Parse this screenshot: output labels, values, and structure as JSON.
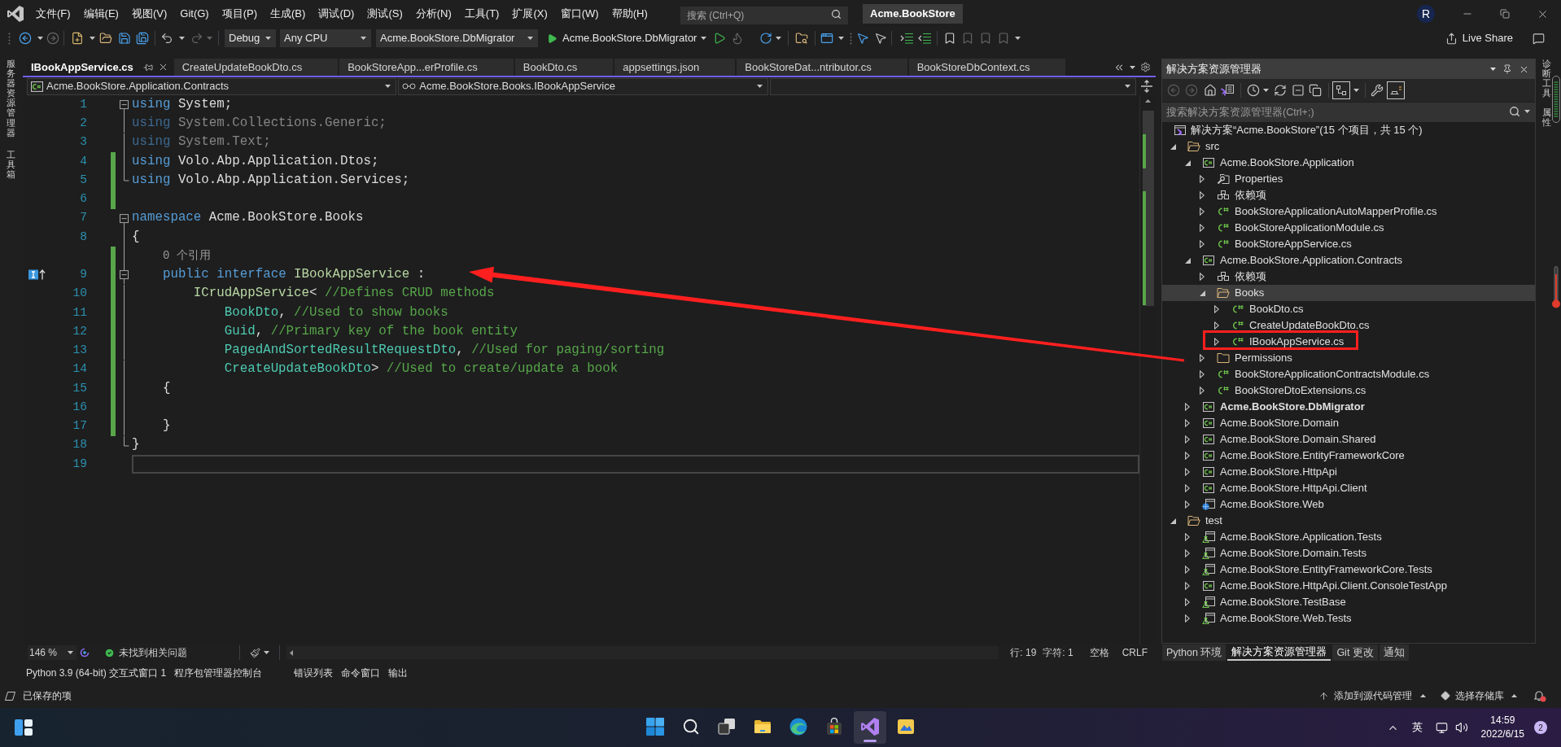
{
  "menu_bar": {
    "items": [
      "文件(F)",
      "编辑(E)",
      "视图(V)",
      "Git(G)",
      "项目(P)",
      "生成(B)",
      "调试(D)",
      "测试(S)",
      "分析(N)",
      "工具(T)",
      "扩展(X)",
      "窗口(W)",
      "帮助(H)"
    ],
    "search": {
      "placeholder": "搜索 (Ctrl+Q)"
    },
    "solution_name": "Acme.BookStore",
    "account_initial": "R"
  },
  "toolbar": {
    "configuration": "Debug",
    "platform": "Any CPU",
    "startup_project": "Acme.BookStore.DbMigrator",
    "run_target": "Acme.BookStore.DbMigrator",
    "live_share": "Live Share"
  },
  "left_strip": [
    "服务器资源管理器",
    "工具箱"
  ],
  "editor": {
    "tabs": [
      {
        "label": "IBookAppService.cs",
        "selected": true
      },
      {
        "label": "CreateUpdateBookDto.cs",
        "selected": false
      },
      {
        "label": "BookStoreApp...erProfile.cs",
        "selected": false
      },
      {
        "label": "BookDto.cs",
        "selected": false
      },
      {
        "label": "appsettings.json",
        "selected": false
      },
      {
        "label": "BookStoreDat...ntributor.cs",
        "selected": false
      },
      {
        "label": "BookStoreDbContext.cs",
        "selected": false
      }
    ],
    "navigation": {
      "project": "Acme.BookStore.Application.Contracts",
      "type": "Acme.BookStore.Books.IBookAppService"
    },
    "lines": [
      {
        "kind": "code",
        "number": "1",
        "tokens": [
          {
            "text": "using",
            "kind": "keyword"
          },
          {
            "text": " System;",
            "kind": "plain"
          }
        ],
        "changed": false,
        "faded": false,
        "fold_start": true,
        "in_fold": false,
        "fold_end": false,
        "marker": false,
        "current": false
      },
      {
        "kind": "code",
        "number": "2",
        "tokens": [
          {
            "text": "using",
            "kind": "keyword"
          },
          {
            "text": " System.Collections.Generic;",
            "kind": "plain"
          }
        ],
        "changed": false,
        "faded": true,
        "fold_start": false,
        "in_fold": true,
        "fold_end": false,
        "marker": false,
        "current": false
      },
      {
        "kind": "code",
        "number": "3",
        "tokens": [
          {
            "text": "using",
            "kind": "keyword"
          },
          {
            "text": " System.Text;",
            "kind": "plain"
          }
        ],
        "changed": false,
        "faded": true,
        "fold_start": false,
        "in_fold": true,
        "fold_end": false,
        "marker": false,
        "current": false
      },
      {
        "kind": "code",
        "number": "4",
        "tokens": [
          {
            "text": "using",
            "kind": "keyword"
          },
          {
            "text": " Volo.Abp.Application.Dtos;",
            "kind": "plain"
          }
        ],
        "changed": true,
        "faded": false,
        "fold_start": false,
        "in_fold": true,
        "fold_end": false,
        "marker": false,
        "current": false
      },
      {
        "kind": "code",
        "number": "5",
        "tokens": [
          {
            "text": "using",
            "kind": "keyword"
          },
          {
            "text": " Volo.Abp.Application.Services;",
            "kind": "plain"
          }
        ],
        "changed": true,
        "faded": false,
        "fold_start": false,
        "in_fold": true,
        "fold_end": true,
        "marker": false,
        "current": false
      },
      {
        "kind": "code",
        "number": "6",
        "changed": true,
        "fold_start": false,
        "in_fold": false,
        "fold_end": false,
        "marker": false,
        "current": false
      },
      {
        "kind": "code",
        "number": "7",
        "tokens": [
          {
            "text": "namespace",
            "kind": "keyword"
          },
          {
            "text": " Acme.BookStore.Books",
            "kind": "plain"
          }
        ],
        "changed": false,
        "faded": false,
        "fold_start": true,
        "in_fold": false,
        "fold_end": false,
        "marker": false,
        "current": false
      },
      {
        "kind": "code",
        "number": "8",
        "tokens": [
          {
            "text": "{",
            "kind": "plain"
          }
        ],
        "changed": false,
        "faded": false,
        "fold_start": false,
        "in_fold": true,
        "fold_end": false,
        "marker": false,
        "current": false
      },
      {
        "kind": "codelens",
        "text": "    0 个引用",
        "changed": true,
        "fold_start": false,
        "in_fold": true,
        "fold_end": false
      },
      {
        "kind": "code",
        "number": "9",
        "tokens": [
          {
            "text": "    public",
            "kind": "keyword"
          },
          {
            "text": " interface",
            "kind": "keyword"
          },
          {
            "text": " IBookAppService",
            "kind": "interface"
          },
          {
            "text": " :",
            "kind": "plain"
          }
        ],
        "changed": true,
        "faded": false,
        "fold_start": true,
        "in_fold": true,
        "fold_end": false,
        "marker": true,
        "current": false
      },
      {
        "kind": "code",
        "number": "10",
        "tokens": [
          {
            "text": "        ICrudAppService",
            "kind": "interface"
          },
          {
            "text": "< ",
            "kind": "plain"
          },
          {
            "text": "//Defines CRUD methods",
            "kind": "comment"
          }
        ],
        "changed": true,
        "faded": false,
        "fold_start": false,
        "in_fold": true,
        "fold_end": false,
        "marker": false,
        "current": false
      },
      {
        "kind": "code",
        "number": "11",
        "tokens": [
          {
            "text": "            BookDto",
            "kind": "type"
          },
          {
            "text": ", ",
            "kind": "plain"
          },
          {
            "text": "//Used to show books",
            "kind": "comment"
          }
        ],
        "changed": true,
        "faded": false,
        "fold_start": false,
        "in_fold": true,
        "fold_end": false,
        "marker": false,
        "current": false
      },
      {
        "kind": "code",
        "number": "12",
        "tokens": [
          {
            "text": "            Guid",
            "kind": "type"
          },
          {
            "text": ", ",
            "kind": "plain"
          },
          {
            "text": "//Primary key of the book entity",
            "kind": "comment"
          }
        ],
        "changed": true,
        "faded": false,
        "fold_start": false,
        "in_fold": true,
        "fold_end": false,
        "marker": false,
        "current": false
      },
      {
        "kind": "code",
        "number": "13",
        "tokens": [
          {
            "text": "            PagedAndSortedResultRequestDto",
            "kind": "type"
          },
          {
            "text": ", ",
            "kind": "plain"
          },
          {
            "text": "//Used for paging/sorting",
            "kind": "comment"
          }
        ],
        "changed": true,
        "faded": false,
        "fold_start": false,
        "in_fold": true,
        "fold_end": false,
        "marker": false,
        "current": false
      },
      {
        "kind": "code",
        "number": "14",
        "tokens": [
          {
            "text": "            CreateUpdateBookDto",
            "kind": "type"
          },
          {
            "text": "> ",
            "kind": "plain"
          },
          {
            "text": "//Used to create/update a book",
            "kind": "comment"
          }
        ],
        "changed": true,
        "faded": false,
        "fold_start": false,
        "in_fold": true,
        "fold_end": false,
        "marker": false,
        "current": false
      },
      {
        "kind": "code",
        "number": "15",
        "tokens": [
          {
            "text": "    {",
            "kind": "plain"
          }
        ],
        "changed": true,
        "faded": false,
        "fold_start": false,
        "in_fold": true,
        "fold_end": false,
        "marker": false,
        "current": false
      },
      {
        "kind": "code",
        "number": "16",
        "changed": true,
        "fold_start": false,
        "in_fold": true,
        "fold_end": false,
        "marker": false,
        "current": false
      },
      {
        "kind": "code",
        "number": "17",
        "tokens": [
          {
            "text": "    }",
            "kind": "plain"
          }
        ],
        "changed": true,
        "faded": false,
        "fold_start": false,
        "in_fold": true,
        "fold_end": false,
        "marker": false,
        "current": false
      },
      {
        "kind": "code",
        "number": "18",
        "tokens": [
          {
            "text": "}",
            "kind": "plain"
          }
        ],
        "changed": false,
        "faded": false,
        "fold_start": false,
        "in_fold": true,
        "fold_end": true,
        "marker": false,
        "current": false
      },
      {
        "kind": "code",
        "number": "19",
        "changed": false,
        "fold_start": false,
        "in_fold": false,
        "fold_end": false,
        "marker": false,
        "current": true
      }
    ],
    "footer": {
      "zoom": "146 %",
      "issues": "未找到相关问题",
      "line": "行: 19",
      "column": "字符: 1",
      "indentation": "空格",
      "line_ending": "CRLF"
    }
  },
  "solution_explorer": {
    "title": "解决方案资源管理器",
    "search": {
      "placeholder": "搜索解决方案资源管理器(Ctrl+;)"
    },
    "solution": {
      "label": "解决方案“Acme.BookStore”(15 个项目，共 15 个)",
      "children": [
        {
          "label": "src",
          "kind": "folder",
          "expanded": true,
          "selected": false,
          "children": [
            {
              "label": "Acme.BookStore.Application",
              "kind": "project",
              "expanded": true,
              "selected": false,
              "children": [
                {
                  "label": "Properties",
                  "kind": "properties",
                  "expanded": false,
                  "selected": false
                },
                {
                  "label": "依赖项",
                  "kind": "dependencies",
                  "expanded": false,
                  "selected": false
                },
                {
                  "label": "BookStoreApplicationAutoMapperProfile.cs",
                  "kind": "csharp-file",
                  "expanded": false,
                  "selected": false
                },
                {
                  "label": "BookStoreApplicationModule.cs",
                  "kind": "csharp-file",
                  "expanded": false,
                  "selected": false
                },
                {
                  "label": "BookStoreAppService.cs",
                  "kind": "csharp-file",
                  "expanded": false,
                  "selected": false
                }
              ]
            },
            {
              "label": "Acme.BookStore.Application.Contracts",
              "kind": "project",
              "expanded": true,
              "selected": false,
              "children": [
                {
                  "label": "依赖项",
                  "kind": "dependencies",
                  "expanded": false,
                  "selected": false
                },
                {
                  "label": "Books",
                  "kind": "folder",
                  "expanded": true,
                  "selected": true,
                  "children": [
                    {
                      "label": "BookDto.cs",
                      "kind": "csharp-file",
                      "expanded": false,
                      "selected": false
                    },
                    {
                      "label": "CreateUpdateBookDto.cs",
                      "kind": "csharp-file",
                      "expanded": false,
                      "selected": false
                    },
                    {
                      "label": "IBookAppService.cs",
                      "kind": "csharp-file",
                      "expanded": false,
                      "selected": false
                    }
                  ]
                },
                {
                  "label": "Permissions",
                  "kind": "folder",
                  "expanded": false,
                  "selected": false
                },
                {
                  "label": "BookStoreApplicationContractsModule.cs",
                  "kind": "csharp-file",
                  "expanded": false,
                  "selected": false
                },
                {
                  "label": "BookStoreDtoExtensions.cs",
                  "kind": "csharp-file",
                  "expanded": false,
                  "selected": false
                }
              ]
            },
            {
              "label": "Acme.BookStore.DbMigrator",
              "kind": "startup-project",
              "expanded": false,
              "selected": false
            },
            {
              "label": "Acme.BookStore.Domain",
              "kind": "project",
              "expanded": false,
              "selected": false
            },
            {
              "label": "Acme.BookStore.Domain.Shared",
              "kind": "project",
              "expanded": false,
              "selected": false
            },
            {
              "label": "Acme.BookStore.EntityFrameworkCore",
              "kind": "project",
              "expanded": false,
              "selected": false
            },
            {
              "label": "Acme.BookStore.HttpApi",
              "kind": "project",
              "expanded": false,
              "selected": false
            },
            {
              "label": "Acme.BookStore.HttpApi.Client",
              "kind": "project",
              "expanded": false,
              "selected": false
            },
            {
              "label": "Acme.BookStore.Web",
              "kind": "web-project",
              "expanded": false,
              "selected": false
            }
          ]
        },
        {
          "label": "test",
          "kind": "folder",
          "expanded": true,
          "selected": false,
          "children": [
            {
              "label": "Acme.BookStore.Application.Tests",
              "kind": "test-project",
              "expanded": false,
              "selected": false
            },
            {
              "label": "Acme.BookStore.Domain.Tests",
              "kind": "test-project",
              "expanded": false,
              "selected": false
            },
            {
              "label": "Acme.BookStore.EntityFrameworkCore.Tests",
              "kind": "test-project",
              "expanded": false,
              "selected": false
            },
            {
              "label": "Acme.BookStore.HttpApi.Client.ConsoleTestApp",
              "kind": "project",
              "expanded": false,
              "selected": false
            },
            {
              "label": "Acme.BookStore.TestBase",
              "kind": "test-project",
              "expanded": false,
              "selected": false
            },
            {
              "label": "Acme.BookStore.Web.Tests",
              "kind": "test-project",
              "expanded": false,
              "selected": false
            }
          ]
        }
      ]
    },
    "tabs": [
      {
        "label": "Python 环境",
        "selected": false
      },
      {
        "label": "解决方案资源管理器",
        "selected": true
      },
      {
        "label": "Git 更改",
        "selected": false
      },
      {
        "label": "通知",
        "selected": false
      }
    ]
  },
  "right_strip": [
    "诊断工具",
    "属性"
  ],
  "tool_window_groups": [
    {
      "tabs": [
        "Python 3.9 (64-bit) 交互式窗口 1",
        "程序包管理器控制台"
      ]
    },
    {
      "tabs": [
        "错误列表",
        "命令窗口",
        "输出"
      ]
    }
  ],
  "status_bar": {
    "message": "已保存的项",
    "source_control": "添加到源代码管理",
    "repository": "选择存储库"
  },
  "taskbar": {
    "apps": [
      {
        "kind": "start",
        "active": false
      },
      {
        "kind": "search",
        "active": false
      },
      {
        "kind": "task-view",
        "active": false
      },
      {
        "kind": "files",
        "active": false
      },
      {
        "kind": "browser",
        "active": false
      },
      {
        "kind": "store",
        "active": false
      },
      {
        "kind": "ide",
        "active": true
      },
      {
        "kind": "tool",
        "active": false
      }
    ],
    "input_method": "英",
    "time": "14:59",
    "date": "2022/6/15",
    "notification_count": "2"
  }
}
